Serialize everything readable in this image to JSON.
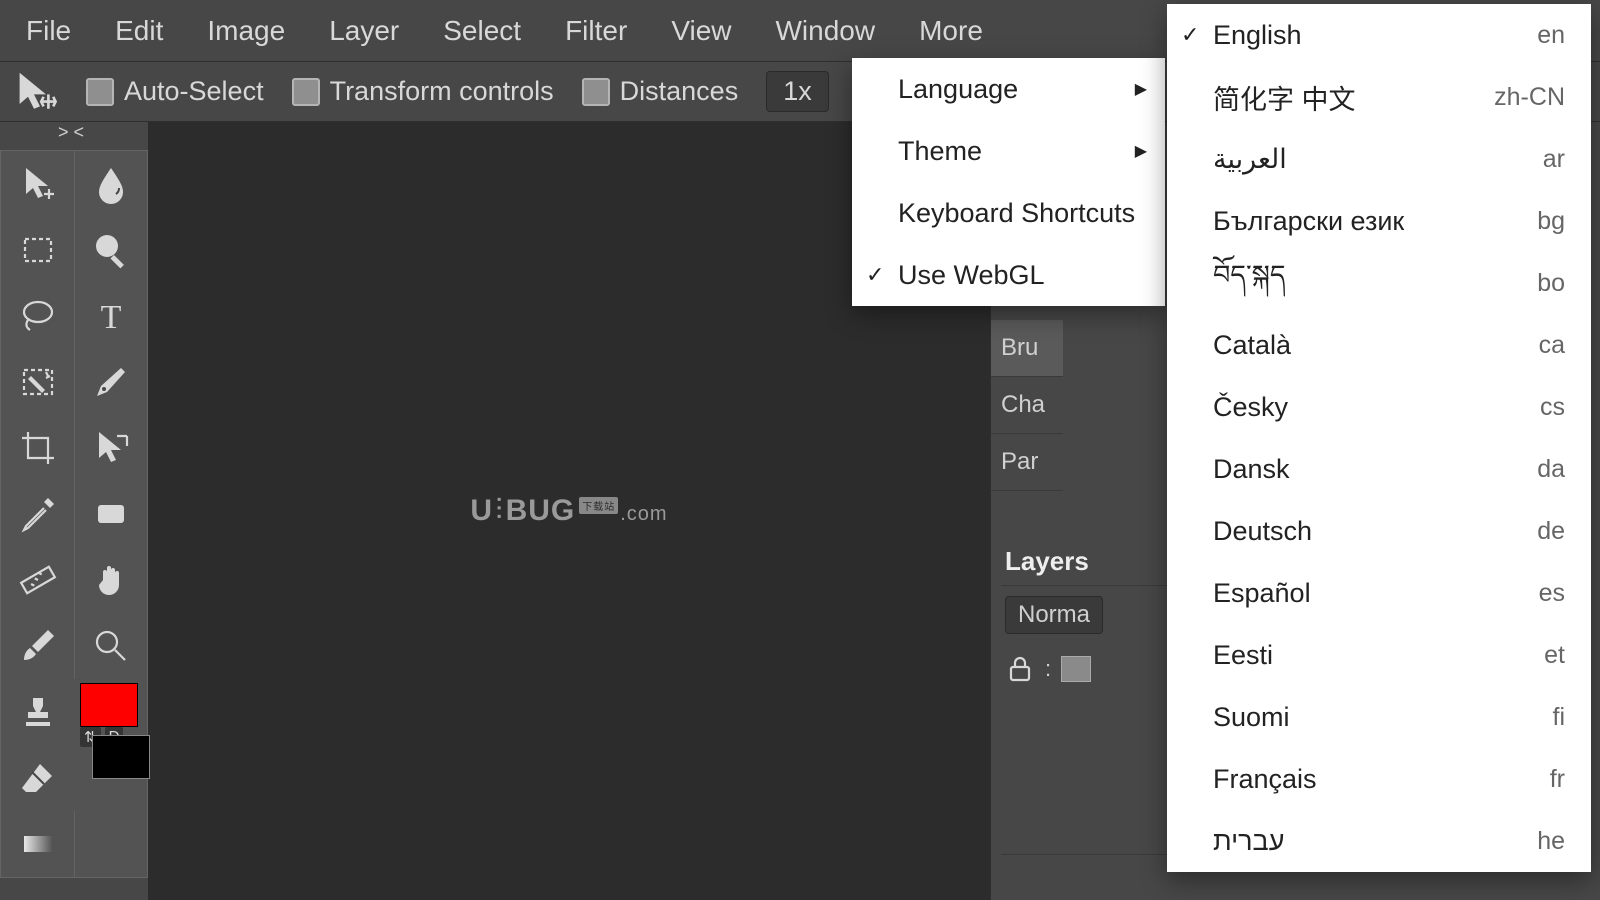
{
  "menubar": {
    "items": [
      "File",
      "Edit",
      "Image",
      "Layer",
      "Select",
      "Filter",
      "View",
      "Window",
      "More"
    ]
  },
  "optionsbar": {
    "auto_select": "Auto-Select",
    "transform_controls": "Transform controls",
    "distances": "Distances",
    "zoom": "1x"
  },
  "tabstrip": {
    "label": "> <"
  },
  "toolbox": {
    "tools_left": [
      "move",
      "rect-select",
      "lasso",
      "magic-select",
      "crop",
      "eyedropper",
      "measure",
      "brush",
      "stamp",
      "eraser",
      "gradient"
    ],
    "tools_right": [
      "blur",
      "magnify",
      "type",
      "pen",
      "path-select",
      "shape",
      "hand",
      "zoom"
    ],
    "fg_color": "#ff0000",
    "bg_color": "#000000",
    "swap_label": "⇅",
    "default_label": "D"
  },
  "watermark": {
    "left": "U",
    "sep": "⫶",
    "mid": "BUG",
    "badge": "下载站",
    "tail": ".com"
  },
  "right_panels": {
    "tabs": [
      "Bru",
      "Cha",
      "Par"
    ],
    "layers_title": "Layers",
    "blend_mode": "Norma",
    "lock_sep": ":"
  },
  "more_menu": {
    "items": [
      {
        "label": "Language",
        "has_sub": true,
        "checked": false
      },
      {
        "label": "Theme",
        "has_sub": true,
        "checked": false
      },
      {
        "label": "Keyboard Shortcuts",
        "has_sub": false,
        "checked": false
      },
      {
        "label": "Use WebGL",
        "has_sub": false,
        "checked": true
      }
    ]
  },
  "language_menu": {
    "items": [
      {
        "label": "English",
        "code": "en",
        "checked": true
      },
      {
        "label": "简化字 中文",
        "code": "zh-CN",
        "checked": false
      },
      {
        "label": "العربية",
        "code": "ar",
        "checked": false
      },
      {
        "label": "Български език",
        "code": "bg",
        "checked": false
      },
      {
        "label": "བོད་སྐད",
        "code": "bo",
        "checked": false
      },
      {
        "label": "Català",
        "code": "ca",
        "checked": false
      },
      {
        "label": "Česky",
        "code": "cs",
        "checked": false
      },
      {
        "label": "Dansk",
        "code": "da",
        "checked": false
      },
      {
        "label": "Deutsch",
        "code": "de",
        "checked": false
      },
      {
        "label": "Español",
        "code": "es",
        "checked": false
      },
      {
        "label": "Eesti",
        "code": "et",
        "checked": false
      },
      {
        "label": "Suomi",
        "code": "fi",
        "checked": false
      },
      {
        "label": "Français",
        "code": "fr",
        "checked": false
      },
      {
        "label": "עברית",
        "code": "he",
        "checked": false
      }
    ]
  }
}
